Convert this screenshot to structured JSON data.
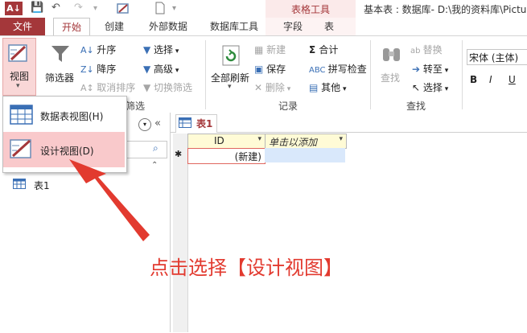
{
  "app": {
    "logo": "A↓",
    "doc_title": "基本表 : 数据库- D:\\我的资料库\\Pictu"
  },
  "context_tab": {
    "title": "表格工具"
  },
  "tabs": {
    "file": "文件",
    "home": "开始",
    "create": "创建",
    "external": "外部数据",
    "dbtools": "数据库工具",
    "fields": "字段",
    "table": "表"
  },
  "ribbon": {
    "view": {
      "label": "视图"
    },
    "filter": {
      "label": "筛选器",
      "asc": "升序",
      "desc": "降序",
      "clear_sort": "取消排序",
      "select": "选择",
      "advanced": "高级",
      "toggle_filter": "切换筛选",
      "group": "筛选"
    },
    "records": {
      "refresh_all": "全部刷新",
      "new": "新建",
      "save": "保存",
      "delete": "删除",
      "totals": "合计",
      "spell": "拼写检查",
      "more": "其他",
      "group": "记录"
    },
    "find": {
      "find": "查找",
      "replace": "替换",
      "goto": "转至",
      "select": "选择",
      "group": "查找"
    },
    "font": {
      "name": "宋体 (主体)",
      "bold": "B",
      "italic": "I",
      "underline": "U"
    }
  },
  "dropdown": {
    "datasheet_view": "数据表视图(H)",
    "design_view": "设计视图(D)"
  },
  "nav": {
    "title_dots": "...",
    "table_item": "表1"
  },
  "doc": {
    "tab_label": "表1"
  },
  "datasheet": {
    "col_id": "ID",
    "col_add": "单击以添加",
    "new_row_marker": "✱",
    "new_value": "(新建)"
  },
  "annotation": "点击选择【设计视图】",
  "colors": {
    "accent": "#a4373a",
    "highlight": "#f9c9cb",
    "annotation": "#e23a2f"
  }
}
